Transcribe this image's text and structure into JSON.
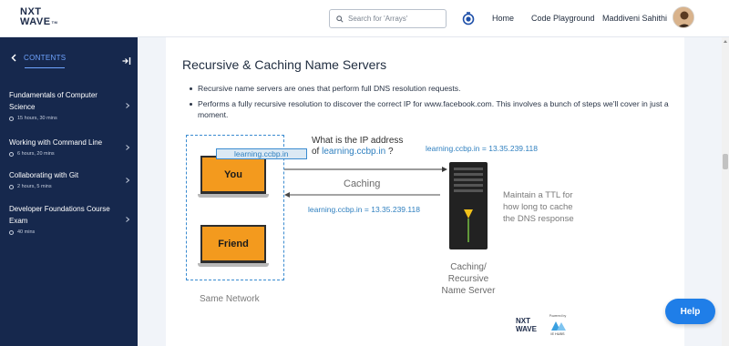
{
  "header": {
    "logo_line1": "NXT",
    "logo_line2": "WAVE",
    "logo_tm": "TM",
    "search": {
      "placeholder": "Search for 'Arrays'",
      "icon": "search-icon"
    },
    "streak_icon": "streak-icon",
    "nav": [
      "Home",
      "Code Playground"
    ],
    "user_name": "Maddiveni Sahithi"
  },
  "sidebar": {
    "contents_label": "CONTENTS",
    "back_icon": "chevron-left-icon",
    "collapse_icon": "collapse-sidebar-icon",
    "courses": [
      {
        "title": "Fundamentals of Computer Science",
        "duration": "15 hours, 30 mins"
      },
      {
        "title": "Working with Command Line",
        "duration": "6 hours, 20 mins"
      },
      {
        "title": "Collaborating with Git",
        "duration": "2 hours, 5 mins"
      },
      {
        "title": "Developer Foundations Course Exam",
        "duration": "40 mins"
      }
    ]
  },
  "content": {
    "section_title": "Recursive & Caching Name Servers",
    "bullets": [
      "Recursive name servers are ones that perform full DNS resolution requests.",
      "Performs a fully recursive resolution to discover the correct IP for www.facebook.com. This involves a bunch of steps we'll cover in just a moment."
    ]
  },
  "diagram": {
    "url_tag": "learning.ccbp.in",
    "laptop_you": "You",
    "laptop_friend": "Friend",
    "query_line1": "What is the IP address",
    "query_line2_prefix": "of ",
    "query_line2_url": "learning.ccbp.in",
    "query_line2_suffix": " ?",
    "resp_top": "learning.ccbp.in = 13.35.239.118",
    "caching": "Caching",
    "resp_bottom": "learning.ccbp.in = 13.35.239.118",
    "ttl_note": "Maintain a TTL for how long to cache the DNS response",
    "server_label": "Caching/ Recursive Name Server",
    "network_label": "Same Network",
    "brand_nxt": "NXT",
    "brand_wave": "WAVE",
    "brand_powered": "Powered by",
    "brand_ie": "IE HUBS"
  },
  "help_button": "Help",
  "colors": {
    "sidebar_bg": "#16284d",
    "accent_blue": "#1f7ee8",
    "laptop_orange": "#f39a1e",
    "link_blue": "#2e7fbf"
  }
}
